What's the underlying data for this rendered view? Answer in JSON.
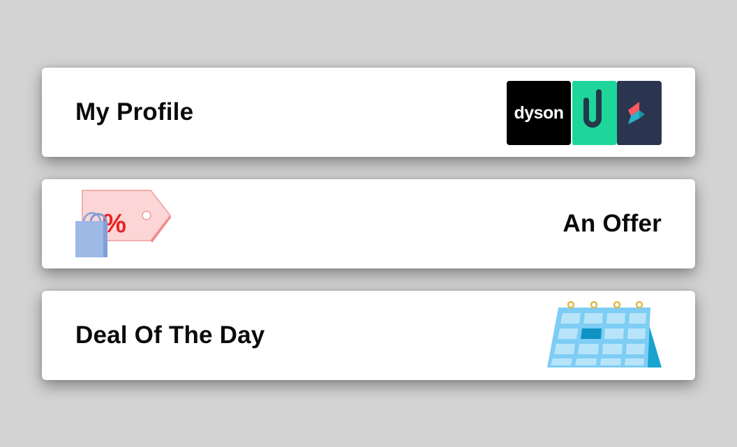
{
  "cards": {
    "profile": {
      "title": "My Profile",
      "logo_text": "dyson"
    },
    "offer": {
      "title": "An Offer",
      "tag_text": "%"
    },
    "deal": {
      "title": "Deal Of The Day"
    }
  },
  "colors": {
    "background": "#d3d3d3",
    "card": "#ffffff",
    "dyson": "#000000",
    "green_logo": "#1ed69a",
    "navy_logo": "#2b3550",
    "tag": "#fcd6d6",
    "percent": "#e82424",
    "bag": "#9db9e6",
    "calendar": "#7dcdf4"
  }
}
